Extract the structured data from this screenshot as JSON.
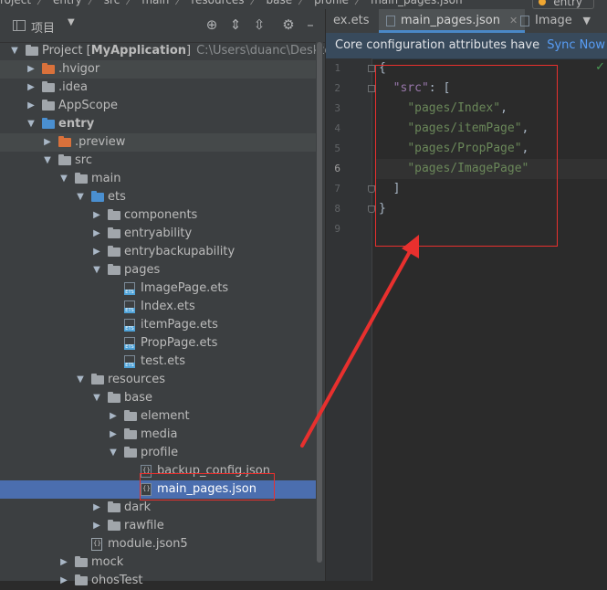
{
  "breadcrumb": {
    "items": [
      "roject",
      "entry",
      "src",
      "main",
      "resources",
      "base",
      "profile",
      "main_pages.json"
    ],
    "separator": "〉",
    "run_config": "entry"
  },
  "project_panel": {
    "view_label": "项目",
    "tree": [
      {
        "label": "Project [MyApplication]",
        "bold_part": "MyApplication",
        "path": "C:\\Users\\duanc\\Desktop\\Fi",
        "depth": 0,
        "arrow": "open",
        "icon": "folder-gray"
      },
      {
        "label": ".hvigor",
        "depth": 1,
        "arrow": "closed",
        "icon": "folder-orange"
      },
      {
        "label": ".idea",
        "depth": 1,
        "arrow": "closed",
        "icon": "folder-gray"
      },
      {
        "label": "AppScope",
        "depth": 1,
        "arrow": "closed",
        "icon": "folder-gray"
      },
      {
        "label": "entry",
        "depth": 1,
        "arrow": "open",
        "icon": "folder-blue",
        "bold": true
      },
      {
        "label": ".preview",
        "depth": 2,
        "arrow": "closed",
        "icon": "folder-orange"
      },
      {
        "label": "src",
        "depth": 2,
        "arrow": "open",
        "icon": "folder-gray"
      },
      {
        "label": "main",
        "depth": 3,
        "arrow": "open",
        "icon": "folder-gray"
      },
      {
        "label": "ets",
        "depth": 4,
        "arrow": "open",
        "icon": "folder-blue"
      },
      {
        "label": "components",
        "depth": 5,
        "arrow": "closed",
        "icon": "folder-gray"
      },
      {
        "label": "entryability",
        "depth": 5,
        "arrow": "closed",
        "icon": "folder-gray"
      },
      {
        "label": "entrybackupability",
        "depth": 5,
        "arrow": "closed",
        "icon": "folder-gray"
      },
      {
        "label": "pages",
        "depth": 5,
        "arrow": "open",
        "icon": "folder-gray"
      },
      {
        "label": "ImagePage.ets",
        "depth": 6,
        "arrow": "none",
        "icon": "file-ets"
      },
      {
        "label": "Index.ets",
        "depth": 6,
        "arrow": "none",
        "icon": "file-ets"
      },
      {
        "label": "itemPage.ets",
        "depth": 6,
        "arrow": "none",
        "icon": "file-ets"
      },
      {
        "label": "PropPage.ets",
        "depth": 6,
        "arrow": "none",
        "icon": "file-ets"
      },
      {
        "label": "test.ets",
        "depth": 6,
        "arrow": "none",
        "icon": "file-ets"
      },
      {
        "label": "resources",
        "depth": 4,
        "arrow": "open",
        "icon": "folder-gray"
      },
      {
        "label": "base",
        "depth": 5,
        "arrow": "open",
        "icon": "folder-gray"
      },
      {
        "label": "element",
        "depth": 6,
        "arrow": "closed",
        "icon": "folder-gray"
      },
      {
        "label": "media",
        "depth": 6,
        "arrow": "closed",
        "icon": "folder-gray"
      },
      {
        "label": "profile",
        "depth": 6,
        "arrow": "open",
        "icon": "folder-gray"
      },
      {
        "label": "backup_config.json",
        "depth": 7,
        "arrow": "none",
        "icon": "file-json"
      },
      {
        "label": "main_pages.json",
        "depth": 7,
        "arrow": "none",
        "icon": "file-json",
        "selected": true
      },
      {
        "label": "dark",
        "depth": 5,
        "arrow": "closed",
        "icon": "folder-gray"
      },
      {
        "label": "rawfile",
        "depth": 5,
        "arrow": "closed",
        "icon": "folder-gray"
      },
      {
        "label": "module.json5",
        "depth": 4,
        "arrow": "none",
        "icon": "file-json5"
      },
      {
        "label": "mock",
        "depth": 3,
        "arrow": "closed",
        "icon": "folder-gray"
      },
      {
        "label": "ohosTest",
        "depth": 3,
        "arrow": "closed",
        "icon": "folder-gray"
      }
    ]
  },
  "editor": {
    "tabs": [
      {
        "label": "ex.ets",
        "active": false
      },
      {
        "label": "main_pages.json",
        "active": true
      },
      {
        "label": "Image",
        "active": false
      }
    ],
    "banner": {
      "message": "Core configuration attributes have cha...",
      "action": "Sync Now"
    },
    "line_numbers": [
      "1",
      "2",
      "3",
      "4",
      "5",
      "6",
      "7",
      "8",
      "9"
    ],
    "current_line": 6,
    "code": [
      {
        "parts": [
          {
            "t": "{",
            "c": "plain"
          }
        ]
      },
      {
        "parts": [
          {
            "t": "  ",
            "c": "plain"
          },
          {
            "t": "\"src\"",
            "c": "key"
          },
          {
            "t": ": [",
            "c": "plain"
          }
        ]
      },
      {
        "parts": [
          {
            "t": "    ",
            "c": "plain"
          },
          {
            "t": "\"pages/Index\"",
            "c": "str"
          },
          {
            "t": ",",
            "c": "plain"
          }
        ]
      },
      {
        "parts": [
          {
            "t": "    ",
            "c": "plain"
          },
          {
            "t": "\"pages/itemPage\"",
            "c": "str"
          },
          {
            "t": ",",
            "c": "plain"
          }
        ]
      },
      {
        "parts": [
          {
            "t": "    ",
            "c": "plain"
          },
          {
            "t": "\"pages/PropPage\"",
            "c": "str"
          },
          {
            "t": ",",
            "c": "plain"
          }
        ]
      },
      {
        "parts": [
          {
            "t": "    ",
            "c": "plain"
          },
          {
            "t": "\"pages/ImagePage\"",
            "c": "str"
          }
        ]
      },
      {
        "parts": [
          {
            "t": "  ]",
            "c": "plain"
          }
        ]
      },
      {
        "parts": [
          {
            "t": "}",
            "c": "plain"
          }
        ]
      },
      {
        "parts": [
          {
            "t": "",
            "c": "plain"
          }
        ]
      }
    ]
  },
  "colors": {
    "annotation": "#e8302e",
    "selection": "#4b6eaf",
    "folder_gray": "#a1a6ab",
    "folder_blue": "#4a8fd0",
    "folder_orange": "#d9713b"
  }
}
